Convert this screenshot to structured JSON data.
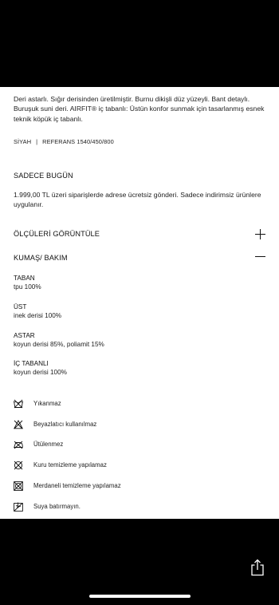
{
  "product": {
    "description": "Deri astarlı. Sığır derisinden üretilmiştir. Burnu dikişli düz yüzeyli. Bant detaylı. Buruşuk suni deri. AIRFIT® iç tabanlı: Üstün konfor sunmak için tasarlanmış esnek teknik köpük iç tabanlı.",
    "color": "SİYAH",
    "separator": "|",
    "reference": "REFERANS 1540/450/800"
  },
  "promo": {
    "title": "SADECE BUGÜN",
    "text": "1.999,00 TL üzeri siparişlerde adrese ücretsiz gönderi. Sadece indirimsiz ürünlere uygulanır."
  },
  "size_guide": {
    "label": "ÖLÇÜLERİ GÖRÜNTÜLE",
    "icon": "plus-icon"
  },
  "fabric_care": {
    "label": "KUMAŞ/ BAKIM",
    "icon": "minus-icon",
    "composition": [
      {
        "part": "TABAN",
        "material": "tpu 100%"
      },
      {
        "part": "ÜST",
        "material": "inek derisi 100%"
      },
      {
        "part": "ASTAR",
        "material": "koyun derisi 85%, poliamit 15%"
      },
      {
        "part": "İÇ TABANLI",
        "material": "koyun derisi 100%"
      }
    ],
    "care": [
      {
        "icon": "do-not-wash-icon",
        "text": "Yıkanmaz"
      },
      {
        "icon": "do-not-bleach-icon",
        "text": "Beyazlatıcı kullanılmaz"
      },
      {
        "icon": "do-not-iron-icon",
        "text": "Ütülenmez"
      },
      {
        "icon": "do-not-dry-clean-icon",
        "text": "Kuru temizleme yapılamaz"
      },
      {
        "icon": "do-not-tumble-dry-icon",
        "text": "Merdaneli temizleme yapılamaz"
      },
      {
        "icon": "do-not-soak-icon",
        "text": "Suya batırmayın."
      }
    ]
  },
  "toolbar": {
    "share_icon": "share-icon"
  }
}
